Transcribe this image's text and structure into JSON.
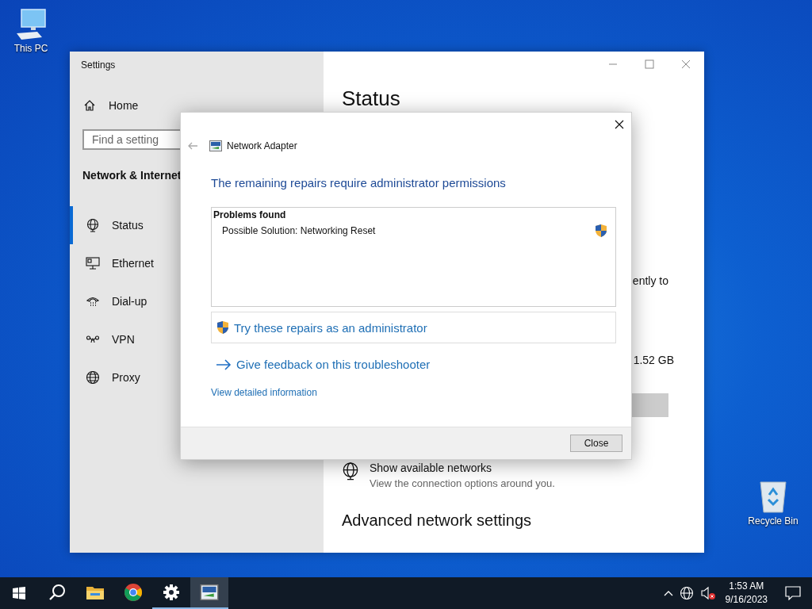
{
  "desktop_icons": [
    {
      "label": "This PC",
      "kind": "computer"
    },
    {
      "label": "Recycle Bin",
      "kind": "recycle"
    }
  ],
  "settings_window": {
    "title": "Settings",
    "home": "Home",
    "search": {
      "placeholder": "Find a setting"
    },
    "section_title": "Network & Internet",
    "nav_items": [
      {
        "label": "Status",
        "kind": "status",
        "selected": true
      },
      {
        "label": "Ethernet",
        "kind": "ethernet",
        "selected": false
      },
      {
        "label": "Dial-up",
        "kind": "dialup",
        "selected": false
      },
      {
        "label": "VPN",
        "kind": "vpn",
        "selected": false
      },
      {
        "label": "Proxy",
        "kind": "proxy",
        "selected": false
      }
    ],
    "page_title": "Status",
    "fragment_1": "ently to",
    "fragment_2": "1.52 GB",
    "show_networks": {
      "title": "Show available networks",
      "description": "View the connection options around you."
    },
    "advanced_heading": "Advanced network settings"
  },
  "dialog": {
    "title": "Network Adapter",
    "heading": "The remaining repairs require administrator permissions",
    "problems": {
      "heading": "Problems found",
      "items": [
        {
          "label": "Possible Solution: Networking Reset",
          "admin": true
        }
      ]
    },
    "admin_action": "Try these repairs as an administrator",
    "feedback_link": "Give feedback on this troubleshooter",
    "details_link": "View detailed information",
    "close_button": "Close"
  },
  "taskbar": {
    "apps": [
      {
        "kind": "search",
        "running": false,
        "active": false
      },
      {
        "kind": "folder",
        "running": false,
        "active": false
      },
      {
        "kind": "browser",
        "running": false,
        "active": false
      },
      {
        "kind": "settings",
        "running": true,
        "active": false
      },
      {
        "kind": "adapter",
        "running": true,
        "active": true
      }
    ],
    "time": "1:53 AM",
    "date": "9/16/2023"
  }
}
